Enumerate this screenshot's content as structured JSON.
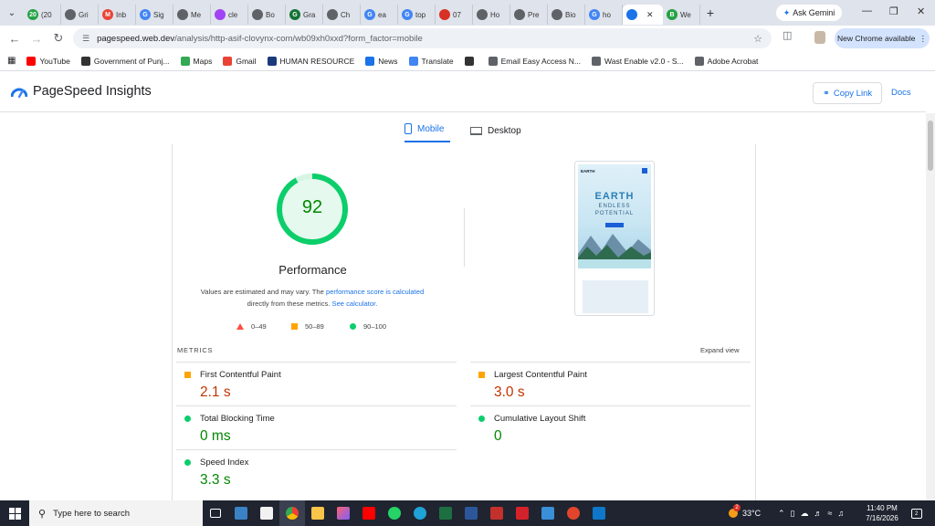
{
  "browser": {
    "tabs": [
      {
        "label": "(20",
        "color": "#25a244",
        "icon": "20"
      },
      {
        "label": "Gri",
        "color": "#5f6368",
        "icon": ""
      },
      {
        "label": "Inb",
        "color": "#ea4335",
        "icon": "M"
      },
      {
        "label": "Sig",
        "color": "#4285f4",
        "icon": "G"
      },
      {
        "label": "Me",
        "color": "#5f6368",
        "icon": ""
      },
      {
        "label": "cle",
        "color": "#a142f4",
        "icon": ""
      },
      {
        "label": "Bo",
        "color": "#5f6368",
        "icon": ""
      },
      {
        "label": "Gra",
        "color": "#137333",
        "icon": "G"
      },
      {
        "label": "Ch",
        "color": "#5f6368",
        "icon": ""
      },
      {
        "label": "ea",
        "color": "#4285f4",
        "icon": "G"
      },
      {
        "label": "top",
        "color": "#4285f4",
        "icon": "G"
      },
      {
        "label": "07",
        "color": "#d93025",
        "icon": ""
      },
      {
        "label": "Ho",
        "color": "#5f6368",
        "icon": ""
      },
      {
        "label": "Pre",
        "color": "#5f6368",
        "icon": ""
      },
      {
        "label": "Bio",
        "color": "#5f6368",
        "icon": ""
      },
      {
        "label": "ho",
        "color": "#4285f4",
        "icon": "G"
      },
      {
        "label": "",
        "color": "#1a73e8",
        "icon": ""
      },
      {
        "label": "We",
        "color": "#25a244",
        "icon": "B"
      }
    ],
    "ask_gemini": "Ask Gemini",
    "url_host": "pagespeed.web.dev",
    "url_path": "/analysis/http-asif-clovynx-com/wb09xh0xxd?form_factor=mobile",
    "new_chrome": "New Chrome available",
    "bookmarks": [
      {
        "label": "YouTube",
        "color": "#ff0000"
      },
      {
        "label": "Government of Punj...",
        "color": "#333333"
      },
      {
        "label": "Maps",
        "color": "#34a853"
      },
      {
        "label": "Gmail",
        "color": "#ea4335"
      },
      {
        "label": "HUMAN RESOURCE",
        "color": "#1a3a7a"
      },
      {
        "label": "News",
        "color": "#1a73e8"
      },
      {
        "label": "Translate",
        "color": "#4285f4"
      },
      {
        "label": "",
        "color": "#333333"
      },
      {
        "label": "Email Easy Access N...",
        "color": "#5f6368"
      },
      {
        "label": "Wast Enable v2.0 - S...",
        "color": "#5f6368"
      },
      {
        "label": "Adobe Acrobat",
        "color": "#5f6368"
      }
    ]
  },
  "psi": {
    "title": "PageSpeed Insights",
    "copy_link": "Copy Link",
    "docs": "Docs",
    "tab_mobile": "Mobile",
    "tab_desktop": "Desktop",
    "score": "92",
    "score_fraction": 0.92,
    "category": "Performance",
    "note_prefix": "Values are estimated and may vary. The ",
    "note_link1": "performance score is calculated",
    "note_mid": "directly from these metrics. ",
    "note_link2": "See calculator.",
    "legend": [
      {
        "label": "0–49",
        "shape": "triangle",
        "color": "#ff4e42"
      },
      {
        "label": "50–89",
        "shape": "square",
        "color": "#ffa400"
      },
      {
        "label": "90–100",
        "shape": "circle",
        "color": "#0cce6b"
      }
    ],
    "preview": {
      "brand": "EARTH",
      "headline": "EARTH",
      "sub1": "ENDLESS",
      "sub2": "POTENTIAL"
    },
    "metrics_label": "METRICS",
    "expand_view": "Expand view",
    "metrics": [
      {
        "name": "First Contentful Paint",
        "value": "2.1 s",
        "status": "avg"
      },
      {
        "name": "Largest Contentful Paint",
        "value": "3.0 s",
        "status": "avg"
      },
      {
        "name": "Total Blocking Time",
        "value": "0 ms",
        "status": "pass"
      },
      {
        "name": "Cumulative Layout Shift",
        "value": "0",
        "status": "pass"
      },
      {
        "name": "Speed Index",
        "value": "3.3 s",
        "status": "pass"
      }
    ]
  },
  "taskbar": {
    "search_placeholder": "Type here to search",
    "temperature": "33°C",
    "weather_badge": "2",
    "time": "11:40 PM",
    "date": "7/16/2026",
    "notif_count": "2"
  }
}
